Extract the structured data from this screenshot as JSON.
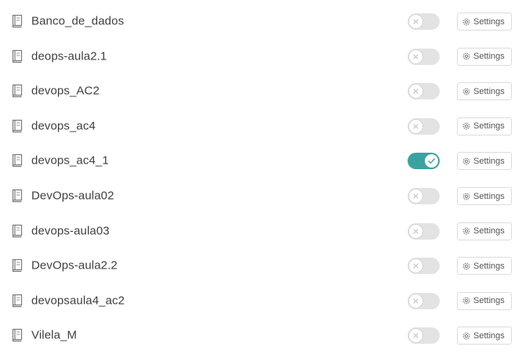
{
  "colors": {
    "toggle_on": "#3aa3a0",
    "toggle_off": "#e3e3e3",
    "text": "#3f3f3f"
  },
  "repositories": [
    {
      "name": "Banco_de_dados",
      "enabled": false,
      "icon": "repo-book-icon",
      "settings_label": "Settings"
    },
    {
      "name": "deops-aula2.1",
      "enabled": false,
      "icon": "repo-book-icon",
      "settings_label": "Settings"
    },
    {
      "name": "devops_AC2",
      "enabled": false,
      "icon": "repo-book-icon",
      "settings_label": "Settings"
    },
    {
      "name": "devops_ac4",
      "enabled": false,
      "icon": "repo-book-icon",
      "settings_label": "Settings"
    },
    {
      "name": "devops_ac4_1",
      "enabled": true,
      "icon": "repo-book-icon",
      "settings_label": "Settings"
    },
    {
      "name": "DevOps-aula02",
      "enabled": false,
      "icon": "repo-book-icon",
      "settings_label": "Settings"
    },
    {
      "name": "devops-aula03",
      "enabled": false,
      "icon": "repo-book-icon",
      "settings_label": "Settings"
    },
    {
      "name": "DevOps-aula2.2",
      "enabled": false,
      "icon": "repo-book-icon",
      "settings_label": "Settings"
    },
    {
      "name": "devopsaula4_ac2",
      "enabled": false,
      "icon": "repo-book-icon",
      "settings_label": "Settings"
    },
    {
      "name": "Vilela_M",
      "enabled": false,
      "icon": "repo-book-icon",
      "settings_label": "Settings"
    }
  ]
}
